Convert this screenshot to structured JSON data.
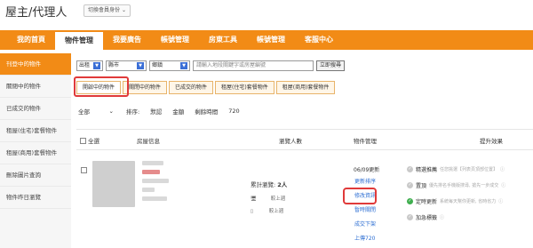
{
  "header": {
    "title": "屋主/代理人",
    "switch_label": "切換會員身份",
    "switch_arrow": "⌄"
  },
  "nav": [
    {
      "label": "我的首頁",
      "active": false
    },
    {
      "label": "物件管理",
      "active": true
    },
    {
      "label": "我要廣告",
      "active": false
    },
    {
      "label": "帳號管理",
      "active": false
    },
    {
      "label": "房東工具",
      "active": false
    },
    {
      "label": "帳號管理",
      "active": false
    },
    {
      "label": "客服中心",
      "active": false
    }
  ],
  "sidebar": [
    {
      "label": "刊登中的物件",
      "active": true
    },
    {
      "label": "關閉中的物件",
      "active": false
    },
    {
      "label": "已成交的物件",
      "active": false
    },
    {
      "label": "租屋(住宅)套餐物件",
      "active": false
    },
    {
      "label": "租屋(商用)套餐物件",
      "active": false
    },
    {
      "label": "刪除圖片查詢",
      "active": false
    },
    {
      "label": "物件昨日瀏覽",
      "active": false
    }
  ],
  "filters": {
    "type": "出租",
    "city": "縣市",
    "district": "鄉鎮",
    "search_placeholder": "請輸入地段關鍵字或房屋編號",
    "search_button": "立即搜尋"
  },
  "tabs": [
    {
      "label": "開啟中的物件",
      "active": true
    },
    {
      "label": "關閉中的物件",
      "active": false
    },
    {
      "label": "已成交的物件",
      "active": false
    },
    {
      "label": "租屋(住宅)套餐物件",
      "active": false
    },
    {
      "label": "租屋(商用)套餐物件",
      "active": false
    }
  ],
  "sort": {
    "scope": "全部",
    "sort_label": "排序:",
    "default": "默認",
    "price": "金額",
    "remaining": "剩餘時間",
    "count": "720"
  },
  "table": {
    "select_all": "全選",
    "col_info": "房屋信息",
    "col_views": "瀏覽人數",
    "col_manage": "物件管理",
    "col_effect": "提升效果"
  },
  "listing": {
    "views_label": "累計瀏覽:",
    "views_value": "2人",
    "device_desktop": "較上週",
    "device_mobile": "較上週",
    "updated": "06/09更新",
    "actions": {
      "refresh": "更新排序",
      "edit": "修改資訊",
      "close": "暫時關閉",
      "deal": "成交下架",
      "upgrade": "上傳720"
    },
    "effects": [
      {
        "title": "精選推薦",
        "tip": "任您挑選【列表頁頂部位置】",
        "green": false
      },
      {
        "title": "置頂",
        "tip": "優先排名手機版搜尋, 搶先一步成交",
        "green": false
      },
      {
        "title": "定時更新",
        "tip": "系統每天幫你更新, 省時省力",
        "green": true
      },
      {
        "title": "加急標籤",
        "tip": "",
        "green": false
      }
    ]
  },
  "colors": {
    "brand_orange": "#f28b16",
    "highlight_red": "#e03a3a",
    "link_blue": "#2e6fd3",
    "tab_border": "#e8b46a"
  }
}
